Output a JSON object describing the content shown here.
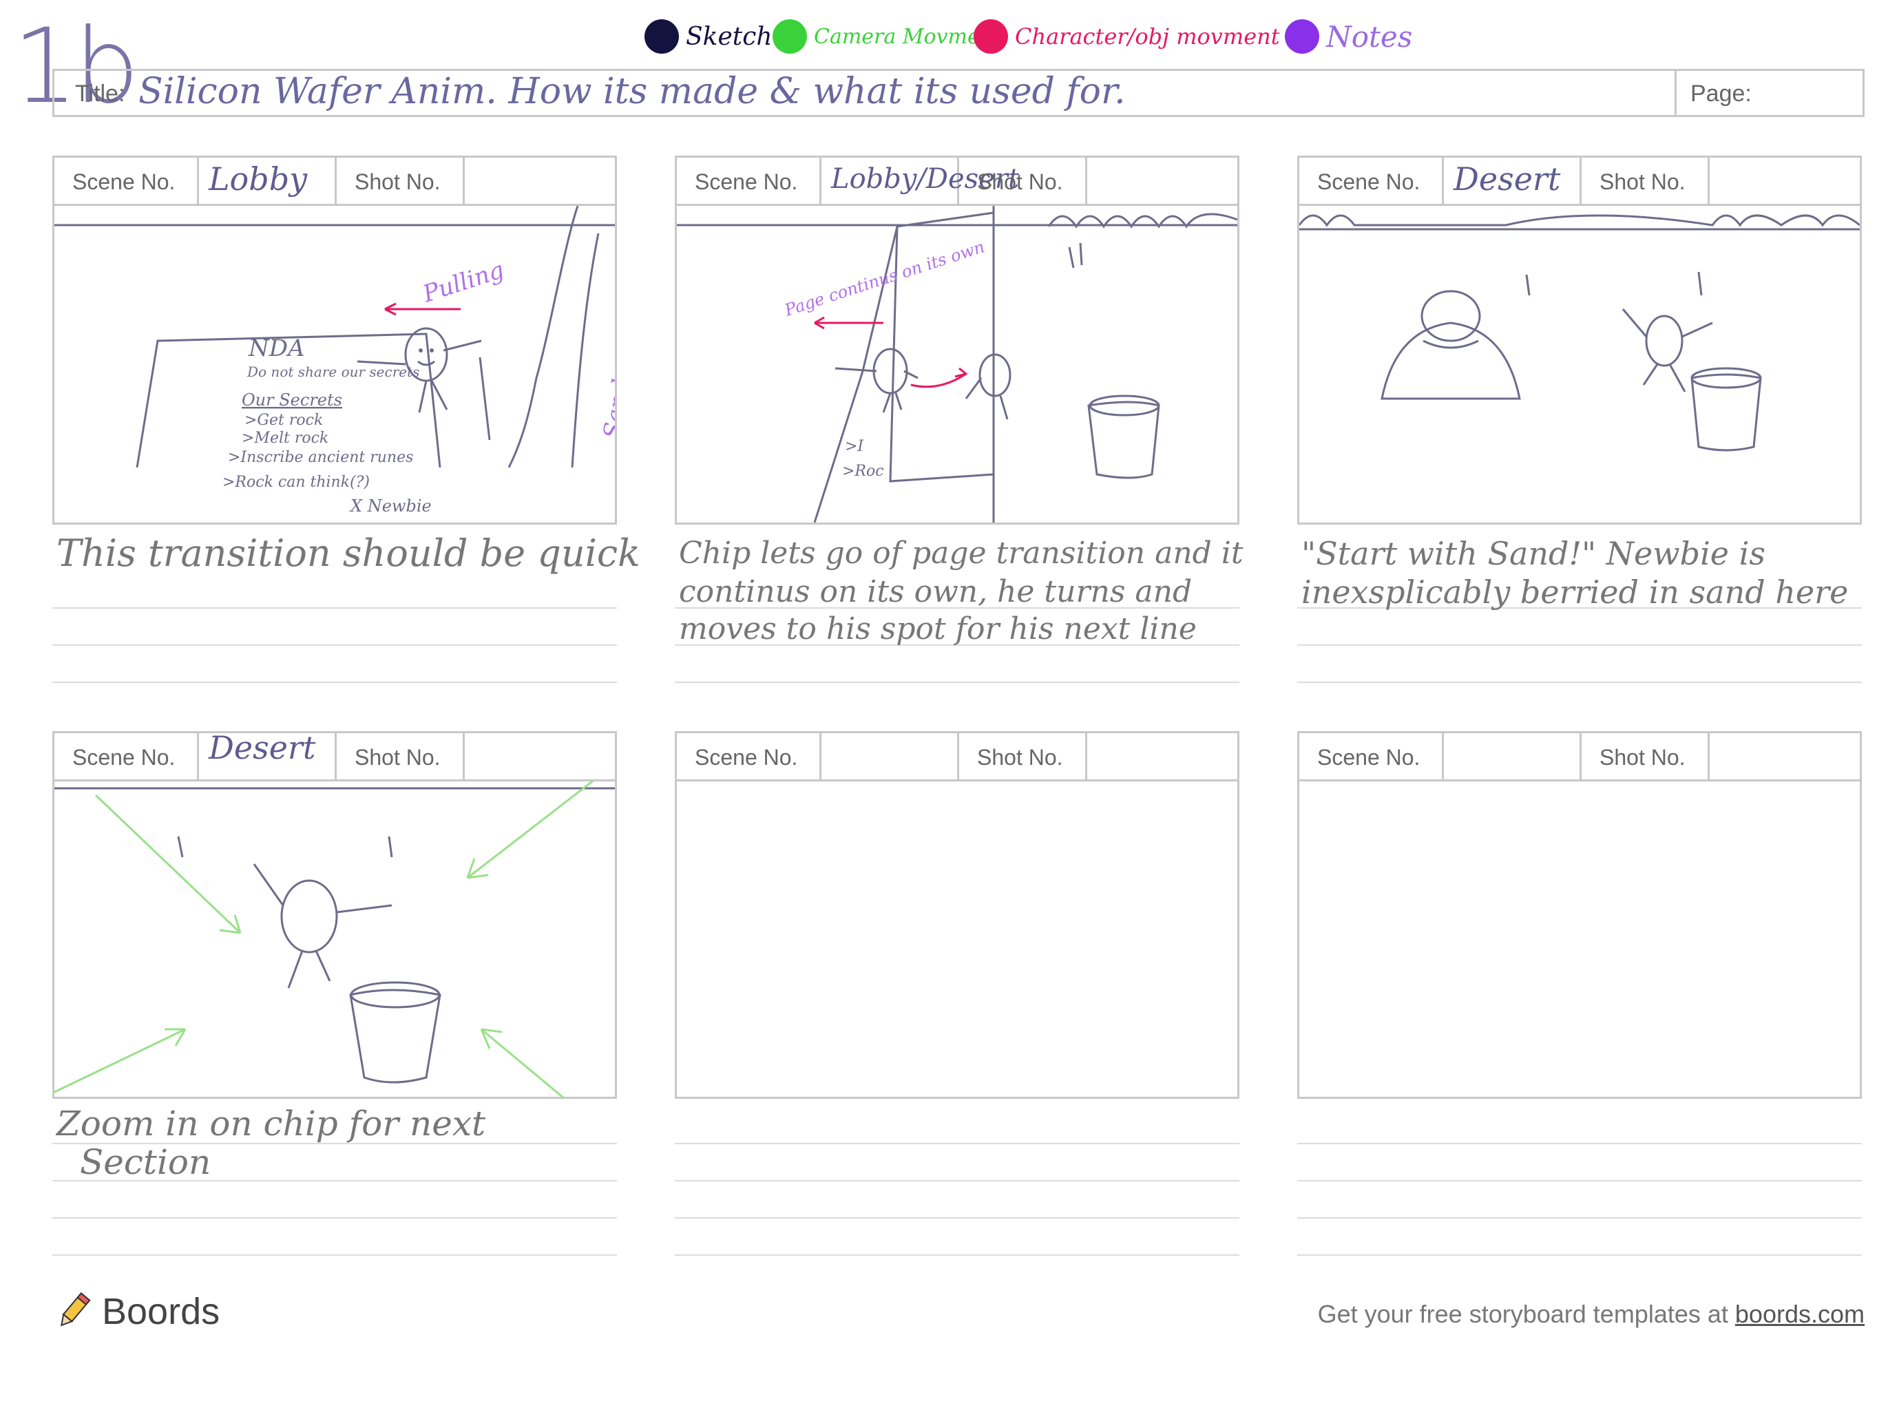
{
  "sheet_id": "1b",
  "legend": [
    {
      "label": "Sketch",
      "color": "#14123f"
    },
    {
      "label": "Camera Movment",
      "color": "#3ad23a"
    },
    {
      "label": "Character/obj movment",
      "color": "#e8185e"
    },
    {
      "label": "Notes",
      "color": "#8a30e8"
    }
  ],
  "title": {
    "label": "Title:",
    "value": "Silicon Wafer Anim. How its made & what its used for.",
    "page_label": "Page:"
  },
  "panel_labels": {
    "scene": "Scene No.",
    "shot": "Shot No."
  },
  "panels": [
    {
      "scene": "Lobby",
      "notes": [
        "This transition should be quick"
      ],
      "art_text": {
        "doc_heading": "NDA",
        "doc_sub": "Do not share our secrets",
        "doc_list_title": "Our Secrets",
        "doc_items": [
          ">Get rock",
          ">Melt rock",
          ">Inscribe ancient runes",
          ">Rock can think(?)"
        ],
        "doc_sign": "X Newbie",
        "pulling": "Pulling",
        "sandy": "Sandy place"
      }
    },
    {
      "scene": "Lobby/Desert",
      "notes": [
        "Chip lets go of page transition and it",
        "continus on its own, he turns and",
        "moves to his spot for his next line"
      ],
      "art_text": {
        "page_note": "Page continus on its own",
        "fragments": [
          ">I",
          ">Roc"
        ]
      }
    },
    {
      "scene": "Desert",
      "notes": [
        "\"Start with Sand!\"  Newbie is",
        "inexsplicably berried in sand here"
      ]
    },
    {
      "scene": "Desert",
      "notes": [
        "Zoom in on chip for next",
        "Section"
      ]
    },
    {
      "scene": "",
      "notes": []
    },
    {
      "scene": "",
      "notes": []
    }
  ],
  "footer": {
    "brand": "Boords",
    "cta": "Get your free storyboard templates at ",
    "link": "boords.com"
  }
}
